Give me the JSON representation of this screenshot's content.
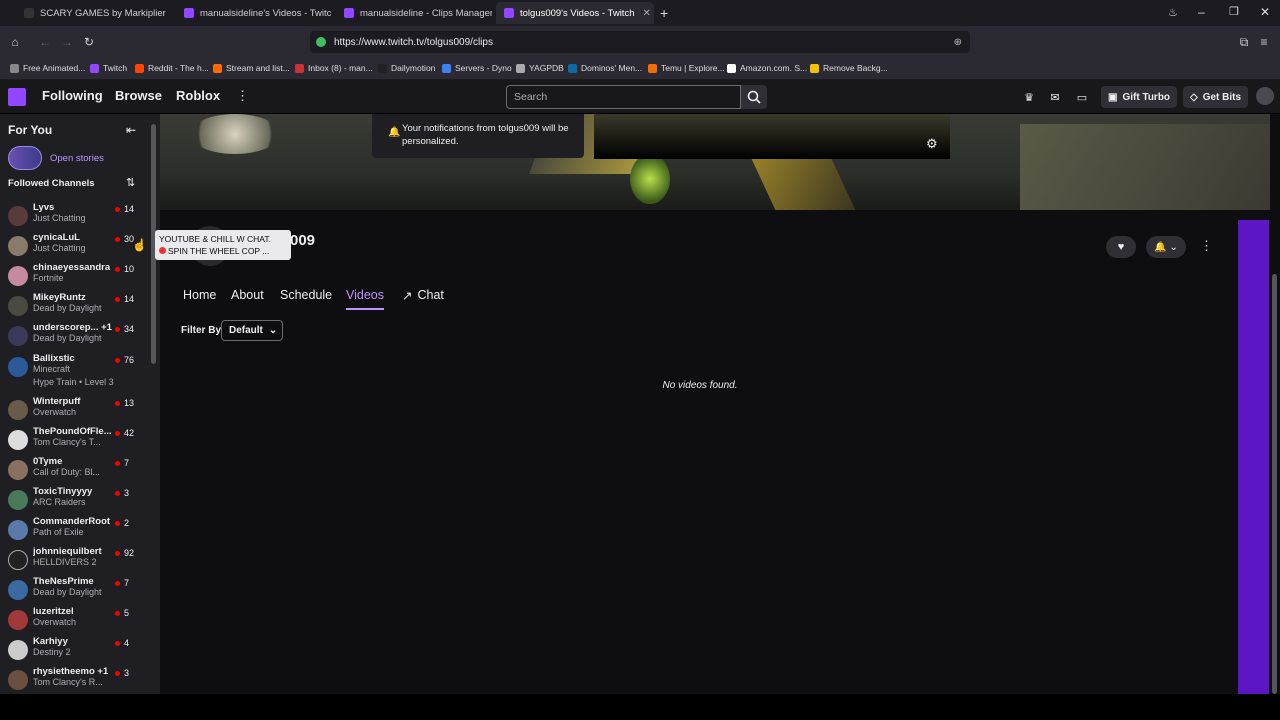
{
  "browser": {
    "tabs": [
      {
        "label": "SCARY GAMES by Markiplier - Dai",
        "active": false
      },
      {
        "label": "manualsideline's Videos - Twitch",
        "active": false
      },
      {
        "label": "manualsideline - Clips Manager -",
        "active": false
      },
      {
        "label": "tolgus009's Videos - Twitch",
        "active": true
      }
    ],
    "url": "https://www.twitch.tv/tolgus009/clips",
    "bookmarks": [
      "Free Animated...",
      "Twitch",
      "Reddit - The h...",
      "Stream and list...",
      "Inbox (8) - man...",
      "Dailymotion",
      "Servers - Dyno",
      "YAGPDB",
      "Dominos' Men...",
      "Temu | Explore...",
      "Amazon.com. S...",
      "Remove Backg..."
    ]
  },
  "topnav": {
    "links": [
      "Following",
      "Browse",
      "Roblox"
    ],
    "search_placeholder": "Search",
    "gift_turbo": "Gift Turbo",
    "get_bits": "Get Bits"
  },
  "sidebar": {
    "for_you": "For You",
    "open_stories": "Open stories",
    "followed_channels": "Followed Channels",
    "channels": [
      {
        "name": "Lyvs",
        "game": "Just Chatting",
        "viewers": "14"
      },
      {
        "name": "cynicaLuL",
        "game": "Just Chatting",
        "viewers": "30"
      },
      {
        "name": "chinaeyessandra",
        "game": "Fortnite",
        "viewers": "10"
      },
      {
        "name": "MikeyRuntz",
        "game": "Dead by Daylight",
        "viewers": "14"
      },
      {
        "name": "underscorep... +1",
        "game": "Dead by Daylight",
        "viewers": "34"
      },
      {
        "name": "Ballixstic",
        "game": "Minecraft",
        "viewers": "76"
      },
      {
        "name": "Winterpuff",
        "game": "Overwatch",
        "viewers": "13"
      },
      {
        "name": "ThePoundOfFle...",
        "game": "Tom Clancy's T...",
        "viewers": "42"
      },
      {
        "name": "0Tyme",
        "game": "Call of Duty: Bl...",
        "viewers": "7"
      },
      {
        "name": "ToxicTinyyyy",
        "game": "ARC Raiders",
        "viewers": "3"
      },
      {
        "name": "CommanderRoot",
        "game": "Path of Exile",
        "viewers": "2"
      },
      {
        "name": "johnniequilbert",
        "game": "HELLDIVERS 2",
        "viewers": "92"
      },
      {
        "name": "TheNesPrime",
        "game": "Dead by Daylight",
        "viewers": "7"
      },
      {
        "name": "luzeritzel",
        "game": "Overwatch",
        "viewers": "5"
      },
      {
        "name": "Karhiyy",
        "game": "Destiny 2",
        "viewers": "4"
      },
      {
        "name": "rhysietheemo +1",
        "game": "Tom Clancy's R...",
        "viewers": "3"
      }
    ],
    "hype_train": "Hype Train • Level 3",
    "tooltip_line1": "YOUTUBE & CHILL W CHAT.",
    "tooltip_line2": "SPIN THE WHEEL COP ..."
  },
  "channel": {
    "name_partial": "009",
    "notification": "Your notifications from tolgus009 will be personalized.",
    "tabs": [
      "Home",
      "About",
      "Schedule",
      "Videos",
      "Chat"
    ],
    "active_tab": "Videos",
    "filter_label": "Filter By",
    "filter_value": "Default",
    "empty_message": "No videos found."
  },
  "colors": {
    "accent": "#bf94ff",
    "brand": "#9147ff",
    "live": "#eb0400",
    "purple_panel": "#5c16c5"
  }
}
